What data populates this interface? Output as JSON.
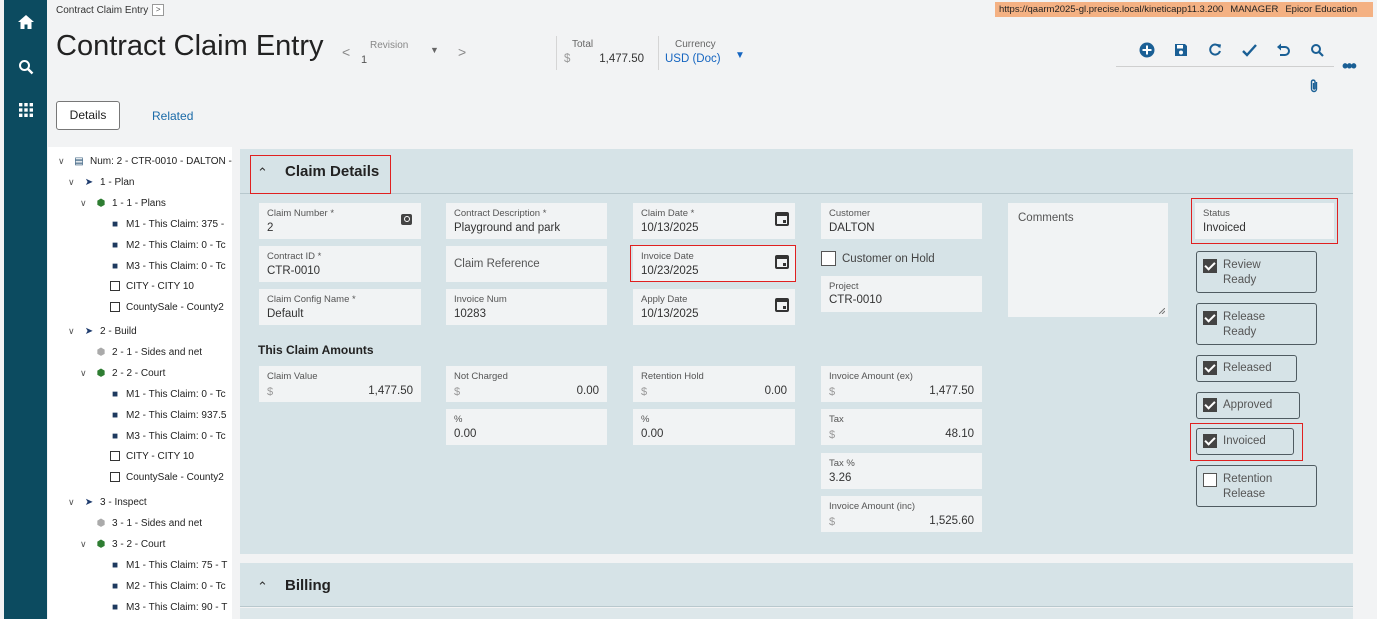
{
  "env": {
    "url": "https://qaarm2025-gl.precise.local/kineticapp11.3.200",
    "user": "MANAGER",
    "company": "Epicor Education"
  },
  "breadcrumb": {
    "label": "Contract Claim Entry",
    "button": ">"
  },
  "page": {
    "title": "Contract Claim Entry"
  },
  "revision": {
    "label": "Revision",
    "value": "1",
    "prev": "<",
    "next": ">"
  },
  "total": {
    "label": "Total",
    "currency_symbol": "$",
    "value": "1,477.50"
  },
  "currency": {
    "label": "Currency",
    "value": "USD (Doc)"
  },
  "toolbar": [
    "add-icon",
    "save-icon",
    "refresh-icon",
    "clear-icon",
    "undo-icon",
    "search-icon"
  ],
  "tabs": {
    "details": "Details",
    "related": "Related"
  },
  "tree": [
    {
      "label": "Num: 2 - CTR-0010 - DALTON -",
      "icon": "doc-icon"
    },
    {
      "label": "1 - Plan",
      "icon": "flag-icon"
    },
    {
      "label": "1 - 1 - Plans",
      "icon": "hex-icon"
    },
    {
      "label": "M1 - This Claim: 375 -",
      "icon": "square-icon"
    },
    {
      "label": "M2 - This Claim: 0 - Tc",
      "icon": "square-icon"
    },
    {
      "label": "M3 - This Claim: 0 - Tc",
      "icon": "square-icon"
    },
    {
      "label": "CITY - CITY 10",
      "icon": "grid-icon"
    },
    {
      "label": "CountySale - County2",
      "icon": "grid-icon"
    },
    {
      "label": "2 - Build",
      "icon": "flag-icon"
    },
    {
      "label": "2 - 1 - Sides and net",
      "icon": "hex-grey-icon"
    },
    {
      "label": "2 - 2 - Court",
      "icon": "hex-icon"
    },
    {
      "label": "M1 - This Claim: 0 - Tc",
      "icon": "square-icon"
    },
    {
      "label": "M2 - This Claim: 937.5",
      "icon": "square-icon"
    },
    {
      "label": "M3 - This Claim: 0 - Tc",
      "icon": "square-icon"
    },
    {
      "label": "CITY - CITY 10",
      "icon": "grid-icon"
    },
    {
      "label": "CountySale - County2",
      "icon": "grid-icon"
    },
    {
      "label": "3 - Inspect",
      "icon": "flag-icon"
    },
    {
      "label": "3 - 1 - Sides and net",
      "icon": "hex-grey-icon"
    },
    {
      "label": "3 - 2 - Court",
      "icon": "hex-icon"
    },
    {
      "label": "M1 - This Claim: 75 - T",
      "icon": "square-icon"
    },
    {
      "label": "M2 - This Claim: 0 - Tc",
      "icon": "square-icon"
    },
    {
      "label": "M3 - This Claim: 90 - T",
      "icon": "square-icon"
    }
  ],
  "claim": {
    "section_title": "Claim Details",
    "claim_number": {
      "label": "Claim Number *",
      "value": "2"
    },
    "contract_id": {
      "label": "Contract ID *",
      "value": "CTR-0010"
    },
    "claim_config": {
      "label": "Claim Config Name *",
      "value": "Default"
    },
    "contract_desc": {
      "label": "Contract Description *",
      "value": "Playground and park"
    },
    "claim_reference": {
      "placeholder": "Claim Reference"
    },
    "invoice_num": {
      "label": "Invoice Num",
      "value": "10283"
    },
    "claim_date": {
      "label": "Claim Date *",
      "value": "10/13/2025"
    },
    "invoice_date": {
      "label": "Invoice Date",
      "value": "10/23/2025"
    },
    "apply_date": {
      "label": "Apply Date",
      "value": "10/13/2025"
    },
    "customer": {
      "label": "Customer",
      "value": "DALTON"
    },
    "customer_on_hold": {
      "label": "Customer on Hold",
      "checked": false
    },
    "project": {
      "label": "Project",
      "value": "CTR-0010"
    },
    "comments": {
      "placeholder": "Comments"
    },
    "status": {
      "label": "Status",
      "value": "Invoiced"
    },
    "flags": {
      "review": {
        "line1": "Review",
        "line2": "Ready",
        "checked": true
      },
      "release": {
        "line1": "Release",
        "line2": "Ready",
        "checked": true
      },
      "released": {
        "label": "Released",
        "checked": true
      },
      "approved": {
        "label": "Approved",
        "checked": true
      },
      "invoiced": {
        "label": "Invoiced",
        "checked": true
      },
      "retention": {
        "line1": "Retention",
        "line2": "Release",
        "checked": false
      }
    }
  },
  "amounts": {
    "heading": "This Claim Amounts",
    "currency_symbol": "$",
    "claim_value": {
      "label": "Claim Value",
      "value": "1,477.50"
    },
    "not_charged": {
      "label": "Not Charged",
      "value": "0.00"
    },
    "not_charged_pct": {
      "label": "%",
      "value": "0.00"
    },
    "retention_hold": {
      "label": "Retention Hold",
      "value": "0.00"
    },
    "retention_pct": {
      "label": "%",
      "value": "0.00"
    },
    "invoice_ex": {
      "label": "Invoice Amount (ex)",
      "value": "1,477.50"
    },
    "tax": {
      "label": "Tax",
      "value": "48.10"
    },
    "tax_pct": {
      "label": "Tax %",
      "value": "3.26"
    },
    "invoice_inc": {
      "label": "Invoice Amount (inc)",
      "value": "1,525.60"
    }
  },
  "billing": {
    "section_title": "Billing"
  }
}
